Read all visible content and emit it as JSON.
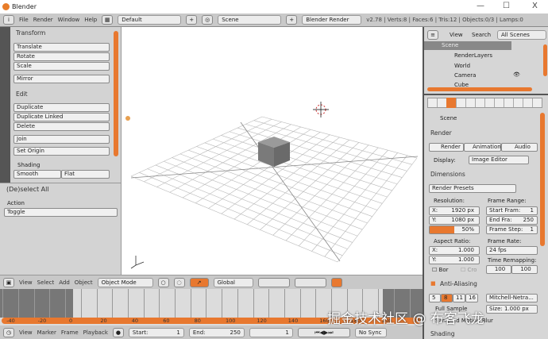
{
  "window": {
    "title": "Blender",
    "minimize": "—",
    "maximize": "☐",
    "close": "X"
  },
  "menubar": {
    "menus": [
      "File",
      "Render",
      "Window",
      "Help"
    ],
    "layout": "Default",
    "scene": "Scene",
    "engine": "Blender Render",
    "stats": "v2.78 | Verts:8 | Faces:6 | Tris:12 | Objects:0/3 | Lamps:0"
  },
  "toolshelf": {
    "transform_header": "Transform",
    "translate": "Translate",
    "rotate": "Rotate",
    "scale": "Scale",
    "mirror": "Mirror",
    "edit_header": "Edit",
    "duplicate": "Duplicate",
    "duplicate_linked": "Duplicate Linked",
    "delete": "Delete",
    "join": "Join",
    "set_origin": "Set Origin",
    "shading_label": "Shading",
    "smooth": "Smooth",
    "flat": "Flat"
  },
  "operator": {
    "header": "(De)select All",
    "action_label": "Action",
    "action_value": "Toggle"
  },
  "view_header": {
    "menus": [
      "View",
      "Select",
      "Add",
      "Object"
    ],
    "mode": "Object Mode",
    "orientation": "Global"
  },
  "timeline": {
    "ticks": [
      -40,
      -20,
      0,
      20,
      40,
      60,
      80,
      100,
      120,
      140,
      160,
      180,
      200,
      220
    ],
    "progress": 0
  },
  "timeline_header": {
    "menus": [
      "View",
      "Marker",
      "Frame",
      "Playback"
    ],
    "start_label": "Start:",
    "start": "1",
    "end_label": "End:",
    "end": "250",
    "current": "1",
    "sync": "No Sync"
  },
  "outliner": {
    "view": "View",
    "search": "Search",
    "filter": "All Scenes",
    "items": [
      "Scene",
      "RenderLayers",
      "World",
      "Camera",
      "Cube"
    ]
  },
  "properties": {
    "context": "Scene",
    "render_header": "Render",
    "render_btn": "Render",
    "animation_btn": "Animation",
    "audio_btn": "Audio",
    "display_label": "Display:",
    "display_value": "Image Editor",
    "dimensions_header": "Dimensions",
    "presets": "Render Presets",
    "resolution_label": "Resolution:",
    "res_x_label": "X:",
    "res_x": "1920 px",
    "res_y_label": "Y:",
    "res_y": "1080 px",
    "res_pct": "50%",
    "res_pct_value": 50,
    "frame_range_label": "Frame Range:",
    "start_frame_label": "Start Fram:",
    "start_frame": "1",
    "end_frame_label": "End Fra:",
    "end_frame": "250",
    "frame_step_label": "Frame Step:",
    "frame_step": "1",
    "aspect_label": "Aspect Ratio:",
    "aspect_x_label": "X:",
    "aspect_x": "1.000",
    "aspect_y_label": "Y:",
    "aspect_y": "1.000",
    "frame_rate_label": "Frame Rate:",
    "frame_rate": "24 fps",
    "border": "Bor",
    "crop": "Cro",
    "remap_label": "Time Remapping:",
    "remap_old": "100",
    "remap_new": "100",
    "aa_header": "Anti-Aliasing",
    "aa_samples": [
      "5",
      "8",
      "11",
      "16"
    ],
    "aa_filter": "Mitchell-Netra...",
    "full_sample": "Full Sample",
    "size": "Size: 1.000 px",
    "sampled_motion": "Sampled Motion Blur",
    "shading_header": "Shading"
  },
  "watermark": "掘金技术社区 @ 布客飞龙",
  "colors": {
    "accent": "#e8782f"
  }
}
